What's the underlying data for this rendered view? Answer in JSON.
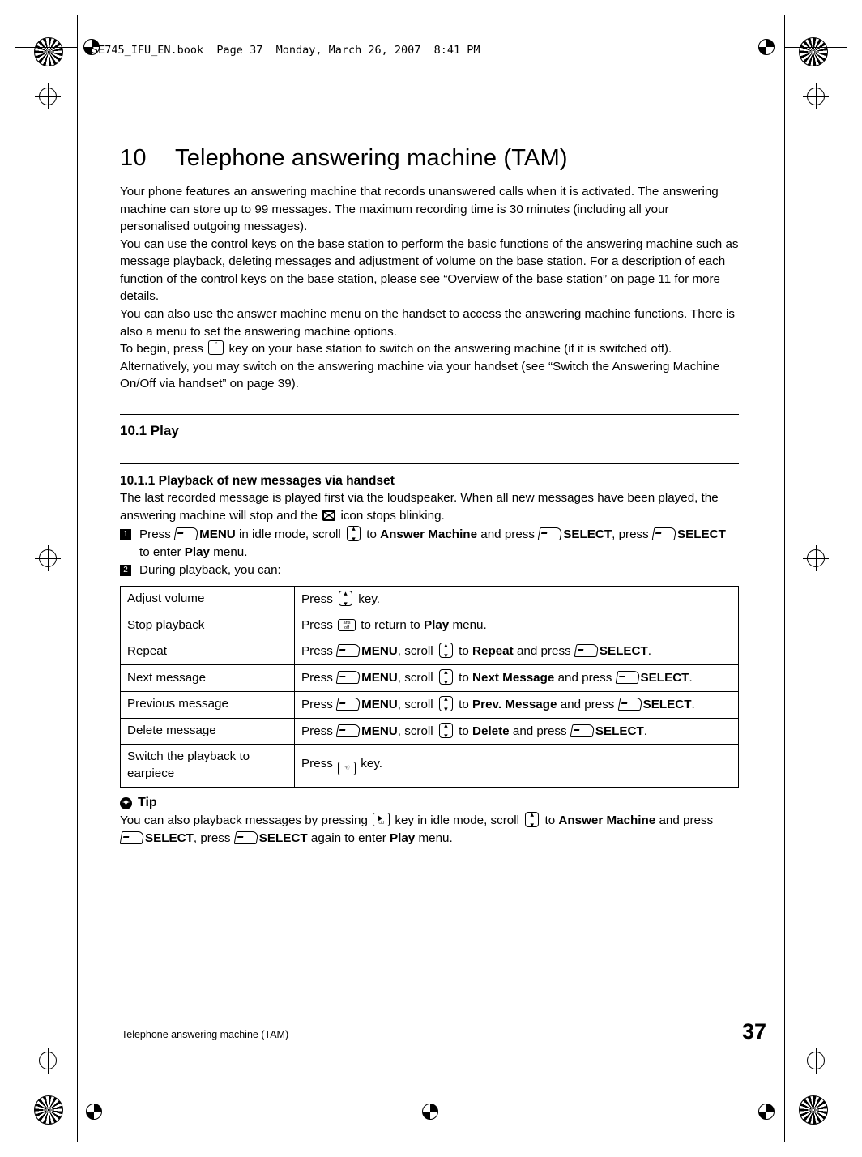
{
  "page": {
    "header_line": "SE745_IFU_EN.book  Page 37  Monday, March 26, 2007  8:41 PM",
    "footer_left": "Telephone answering machine (TAM)",
    "page_number": "37"
  },
  "chapter": {
    "number": "10",
    "title": "Telephone answering machine (TAM)"
  },
  "intro": {
    "p1": "Your phone features an answering machine that records unanswered calls when it is activated. The answering machine can store up to 99 messages. The maximum recording time is 30 minutes (including all your personalised outgoing messages).",
    "p2": "You can use the control keys on the base station to perform the basic functions of the answering machine such as message playback, deleting messages and adjustment of volume on the base station. For a description of each function of the control keys on the base station, please see “Overview of the base station” on page 11 for more details.",
    "p3": "You can also use the answer machine menu on the handset to access the answering machine functions. There is also a menu to set the answering machine options.",
    "p4_a": "To begin, press",
    "p4_b": "key on your base station to switch on the answering machine (if it is switched off). Alternatively, you may switch on the answering machine via your handset (see “Switch the Answering Machine On/Off via handset” on page 39)."
  },
  "section": {
    "number_title": "10.1  Play",
    "subsection_title": "10.1.1  Playback of new messages via handset",
    "lead_a": "The last recorded message is played first via the loudspeaker. When all new messages have been played, the answering machine will stop and the",
    "lead_b": "icon stops blinking."
  },
  "steps": [
    {
      "num": "1",
      "parts": [
        "Press",
        "MENU",
        "in idle mode, scroll",
        "to",
        "Answer Machine",
        "and press",
        "SELECT",
        ", press",
        "SELECT",
        "to enter",
        "Play",
        "menu."
      ]
    },
    {
      "num": "2",
      "text": "During playback, you can:"
    }
  ],
  "table": {
    "rows": [
      {
        "action": "Adjust volume",
        "instruction_parts": [
          "Press",
          "key."
        ]
      },
      {
        "action": "Stop playback",
        "instruction_parts": [
          "Press",
          "to return to",
          "Play",
          "menu."
        ]
      },
      {
        "action": "Repeat",
        "instruction_parts": [
          "Press",
          "MENU",
          ", scroll",
          "to",
          "Repeat",
          "and press",
          "SELECT",
          "."
        ]
      },
      {
        "action": "Next message",
        "instruction_parts": [
          "Press",
          "MENU",
          ", scroll",
          "to",
          "Next Message",
          "and press",
          "SELECT",
          "."
        ]
      },
      {
        "action": "Previous message",
        "instruction_parts": [
          "Press",
          "MENU",
          ", scroll",
          "to",
          "Prev. Message",
          "and press",
          "SELECT",
          "."
        ]
      },
      {
        "action": "Delete message",
        "instruction_parts": [
          "Press",
          "MENU",
          ", scroll",
          "to",
          "Delete",
          "and press",
          "SELECT",
          "."
        ]
      },
      {
        "action": "Switch the playback to earpiece",
        "instruction_parts": [
          "Press",
          "key."
        ]
      }
    ]
  },
  "tip": {
    "label": "Tip",
    "parts": [
      "You can also playback messages by pressing",
      "key in idle mode, scroll",
      "to",
      "Answer Machine",
      "and press",
      "SELECT",
      ", press",
      "SELECT",
      "again to enter",
      "Play",
      "menu."
    ]
  },
  "icons": {
    "softkey": "soft-key-icon",
    "nav_scroll": "nav-scroll-key-icon",
    "volume": "volume-key-icon",
    "ans_off": "answer-off-key-icon",
    "earpiece": "earpiece-key-icon",
    "tam_message": "tam-message-icon",
    "cid_playback": "cid-playback-key-icon",
    "ansm_on": "answering-machine-key-icon"
  }
}
